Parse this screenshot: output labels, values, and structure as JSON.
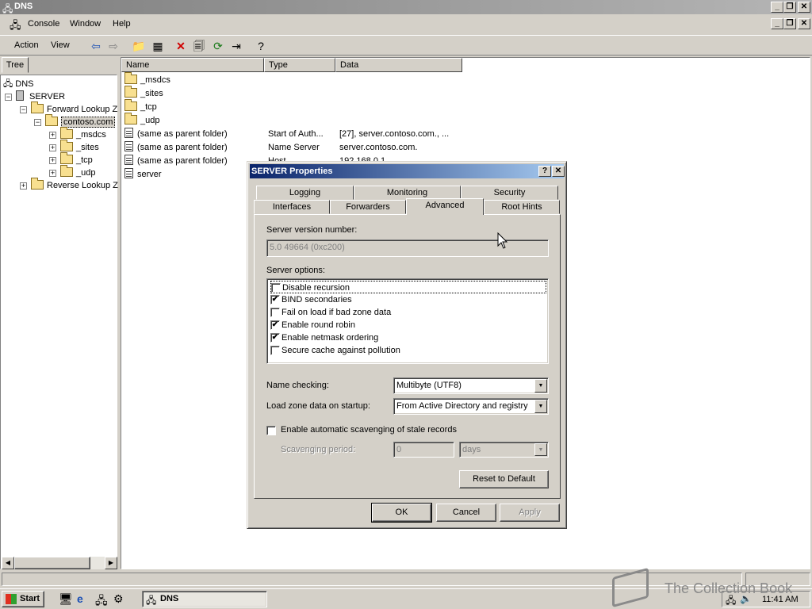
{
  "window": {
    "title": "DNS"
  },
  "menu": {
    "console": "Console",
    "window": "Window",
    "help": "Help"
  },
  "toolbar": {
    "action": "Action",
    "view": "View"
  },
  "tree": {
    "tab": "Tree",
    "items": [
      {
        "label": "DNS"
      },
      {
        "label": "SERVER"
      },
      {
        "label": "Forward Lookup Z"
      },
      {
        "label": "contoso.com"
      },
      {
        "label": "_msdcs"
      },
      {
        "label": "_sites"
      },
      {
        "label": "_tcp"
      },
      {
        "label": "_udp"
      },
      {
        "label": "Reverse Lookup Z"
      }
    ]
  },
  "list": {
    "columns": [
      "Name",
      "Type",
      "Data"
    ],
    "rows": [
      {
        "name": "_msdcs",
        "type": "",
        "data": ""
      },
      {
        "name": "_sites",
        "type": "",
        "data": ""
      },
      {
        "name": "_tcp",
        "type": "",
        "data": ""
      },
      {
        "name": "_udp",
        "type": "",
        "data": ""
      },
      {
        "name": "(same as parent folder)",
        "type": "Start of Auth...",
        "data": "[27], server.contoso.com., ..."
      },
      {
        "name": "(same as parent folder)",
        "type": "Name Server",
        "data": "server.contoso.com."
      },
      {
        "name": "(same as parent folder)",
        "type": "Host",
        "data": "192.168.0.1"
      },
      {
        "name": "server",
        "type": "",
        "data": ""
      }
    ]
  },
  "dialog": {
    "title": "SERVER Properties",
    "help_btn": "?",
    "close_btn": "✕",
    "tabs_row1": [
      "Logging",
      "Monitoring",
      "Security"
    ],
    "tabs_row2": [
      "Interfaces",
      "Forwarders",
      "Advanced",
      "Root Hints"
    ],
    "active_tab": "Advanced",
    "version_label": "Server version number:",
    "version_value": "5.0 49664 (0xc200)",
    "options_label": "Server options:",
    "options": [
      {
        "label": "Disable recursion",
        "checked": false
      },
      {
        "label": "BIND secondaries",
        "checked": true
      },
      {
        "label": "Fail on load if bad zone data",
        "checked": false
      },
      {
        "label": "Enable round robin",
        "checked": true
      },
      {
        "label": "Enable netmask ordering",
        "checked": true
      },
      {
        "label": "Secure cache against pollution",
        "checked": false
      }
    ],
    "name_checking_label": "Name checking:",
    "name_checking_value": "Multibyte (UTF8)",
    "load_zone_label": "Load zone data on startup:",
    "load_zone_value": "From Active Directory and registry",
    "scavenging_label": "Enable automatic scavenging of stale records",
    "scavenging_period_label": "Scavenging period:",
    "scavenging_period_value": "0",
    "scavenging_unit": "days",
    "reset_btn": "Reset to Default",
    "ok_btn": "OK",
    "cancel_btn": "Cancel",
    "apply_btn": "Apply"
  },
  "taskbar": {
    "start": "Start",
    "task_dns": "DNS",
    "clock": "11:41 AM"
  },
  "watermark": "The Collection Book"
}
